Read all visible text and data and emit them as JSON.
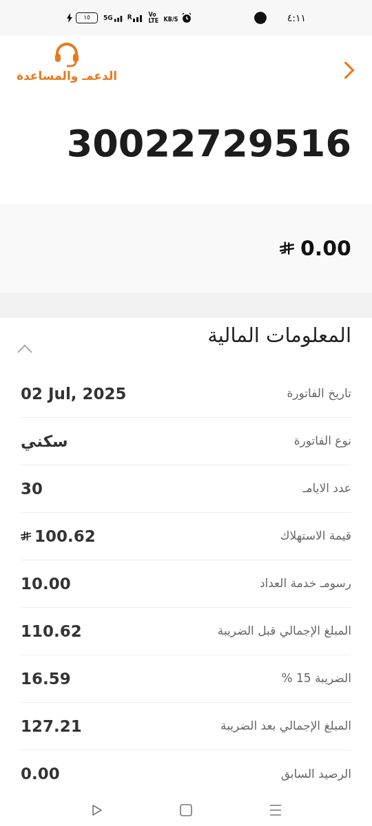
{
  "status_bar": {
    "time": "٤:١١",
    "battery": "١٥",
    "network": "5G",
    "roaming": "R",
    "volte": "Vo LTE",
    "speed": "KB/S"
  },
  "header": {
    "support_label": "الدعمـ والمساعدة"
  },
  "account_number": "30022729516",
  "balance": {
    "amount": "0.00",
    "currency": true
  },
  "section": {
    "title": "المعلومات المالية",
    "expanded": true
  },
  "rows": [
    {
      "label": "تاريخ الفاتورة",
      "value": "02 Jul, 2025",
      "currency": false
    },
    {
      "label": "نوع الفاتورة",
      "value": "سكني",
      "currency": false
    },
    {
      "label": "عدد الايامـ",
      "value": "30",
      "currency": false
    },
    {
      "label": "قيمة الاستهلاك",
      "value": "100.62",
      "currency": true
    },
    {
      "label": "رسومـ خدمة العداد",
      "value": "10.00",
      "currency": false
    },
    {
      "label": "المبلغ الإجمالي قبل الضريبة",
      "value": "110.62",
      "currency": false
    },
    {
      "label": "الضريبة 15 %",
      "value": "16.59",
      "currency": false
    },
    {
      "label": "المبلغ الإجمالي بعد الضريبة",
      "value": "127.21",
      "currency": false
    },
    {
      "label": "الرصيد السابق",
      "value": "0.00",
      "currency": false
    }
  ]
}
